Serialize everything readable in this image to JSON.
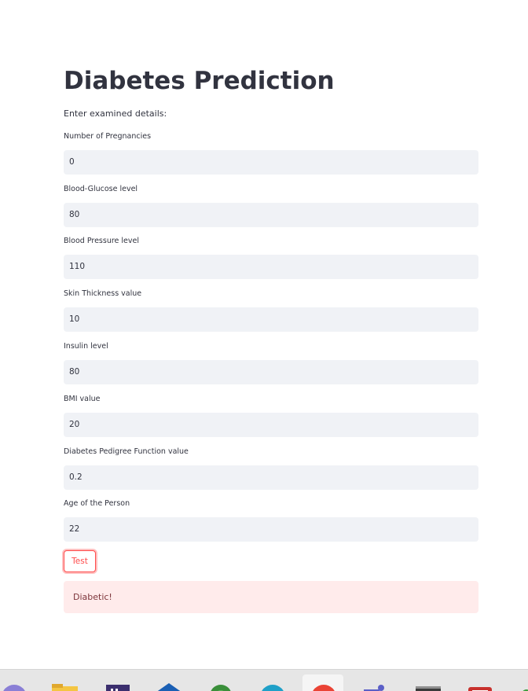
{
  "app": {
    "title": "Diabetes Prediction",
    "intro": "Enter examined details:"
  },
  "fields": [
    {
      "label": "Number of Pregnancies",
      "value": "0"
    },
    {
      "label": "Blood-Glucose level",
      "value": "80"
    },
    {
      "label": "Blood Pressure level",
      "value": "110"
    },
    {
      "label": "Skin Thickness value",
      "value": "10"
    },
    {
      "label": "Insulin level",
      "value": "80"
    },
    {
      "label": "BMI value",
      "value": "20"
    },
    {
      "label": "Diabetes Pedigree Function value",
      "value": "0.2"
    },
    {
      "label": "Age of the Person",
      "value": "22"
    }
  ],
  "actions": {
    "test_label": "Test"
  },
  "result": {
    "text": "Diabetic!"
  },
  "taskbar": {
    "icons": [
      "circle-app-icon",
      "file-explorer-icon",
      "ide-icon",
      "blue-app-icon",
      "green-gear-app-icon",
      "edge-browser-icon",
      "chrome-browser-icon",
      "teams-icon",
      "terminal-icon",
      "red-app-icon",
      "green-app-icon"
    ]
  },
  "colors": {
    "accent": "#ff4b4b",
    "input_bg": "#f0f2f6",
    "error_bg": "#ffebeb",
    "error_text": "#7d353b",
    "text": "#31333f"
  }
}
